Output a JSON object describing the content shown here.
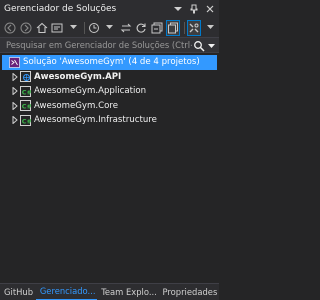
{
  "window": {
    "title": "Gerenciador de Soluções"
  },
  "search": {
    "placeholder": "Pesquisar em Gerenciador de Soluções (Ctrl+ç)"
  },
  "tree": {
    "solution_label": "Solução 'AwesomeGym' (4 de 4 projetos)",
    "projects": [
      {
        "label": "AwesomeGym.API",
        "bold": true
      },
      {
        "label": "AwesomeGym.Application",
        "bold": false
      },
      {
        "label": "AwesomeGym.Core",
        "bold": false
      },
      {
        "label": "AwesomeGym.Infrastructure",
        "bold": false
      }
    ]
  },
  "bottom_tabs": [
    {
      "label": "GitHub",
      "active": false
    },
    {
      "label": "Gerenciado...",
      "active": true
    },
    {
      "label": "Team Explo...",
      "active": false
    },
    {
      "label": "Propriedades",
      "active": false
    }
  ],
  "colors": {
    "accent": "#3399ff",
    "background": "#252526",
    "chrome": "#2d2d30"
  }
}
